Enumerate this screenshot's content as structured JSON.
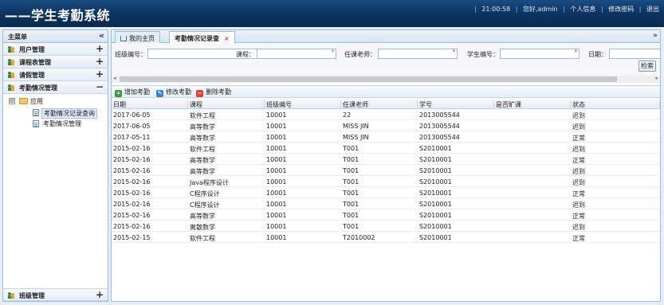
{
  "header": {
    "title": "——学生考勤系统",
    "time": "21:00:58",
    "greeting": "您好,admin",
    "personal_info": "个人信息",
    "change_password": "修改密码",
    "logout": "退出"
  },
  "sidebar": {
    "title": "主菜单",
    "collapse_icon": "«",
    "sections": [
      {
        "label": "用户管理",
        "toggle": "+"
      },
      {
        "label": "课程表管理",
        "toggle": "+"
      },
      {
        "label": "请假管理",
        "toggle": "+"
      },
      {
        "label": "考勤情况管理",
        "toggle": "−"
      }
    ],
    "tree": {
      "root_toggle": "⊟",
      "root_label": "应用",
      "items": [
        "考勤情况记录查询",
        "考勤情况管理"
      ]
    },
    "bottom_section": {
      "label": "班级管理",
      "toggle": "+"
    }
  },
  "tabs": [
    {
      "label": "我的主页"
    },
    {
      "label": "考勤情况记录查"
    }
  ],
  "tab_close": "×",
  "tabs_menu": "»",
  "search": {
    "class_label": "班级编号：",
    "course_label": "课程：",
    "teacher_label": "任课老师：",
    "student_label": "学生编号：",
    "date_label": "日期：",
    "required_mark": "*",
    "button": "检索"
  },
  "toolbar": {
    "add": "增加考勤",
    "edit": "修改考勤",
    "delete": "删除考勤"
  },
  "grid": {
    "columns": [
      "日期",
      "课程",
      "班级编号",
      "任课老师",
      "学号",
      "是否旷课",
      "状态"
    ],
    "rows": [
      [
        "2017-06-05",
        "软件工程",
        "10001",
        "22",
        "2013005544",
        "",
        "迟到"
      ],
      [
        "2017-06-05",
        "高等数学",
        "10001",
        "MISS JIN",
        "2013005544",
        "",
        "迟到"
      ],
      [
        "2017-05-11",
        "高等数学",
        "10001",
        "MISS JIN",
        "2013005544",
        "",
        "正常"
      ],
      [
        "2015-02-16",
        "软件工程",
        "10001",
        "T001",
        "S2010001",
        "",
        "迟到"
      ],
      [
        "2015-02-16",
        "高等数学",
        "10001",
        "T001",
        "S2010001",
        "",
        "正常"
      ],
      [
        "2015-02-16",
        "高等数学",
        "10001",
        "T001",
        "S2010001",
        "",
        "迟到"
      ],
      [
        "2015-02-16",
        "Java程序设计",
        "10001",
        "T001",
        "S2010001",
        "",
        "迟到"
      ],
      [
        "2015-02-16",
        "C程序设计",
        "10001",
        "T001",
        "S2010001",
        "",
        "正常"
      ],
      [
        "2015-02-16",
        "C程序设计",
        "10001",
        "T001",
        "S2010001",
        "",
        "迟到"
      ],
      [
        "2015-02-16",
        "高等数学",
        "10001",
        "T001",
        "S2010001",
        "",
        "正常"
      ],
      [
        "2015-02-16",
        "离散数学",
        "10001",
        "T001",
        "S2010001",
        "",
        "迟到"
      ],
      [
        "2015-02-15",
        "软件工程",
        "10001",
        "T2010002",
        "S2010001",
        "",
        "正常"
      ]
    ]
  }
}
